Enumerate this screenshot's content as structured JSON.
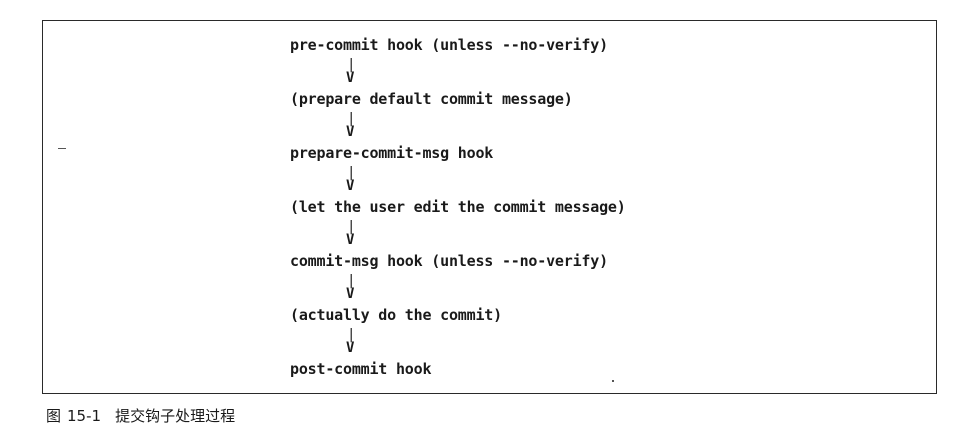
{
  "diagram": {
    "steps": [
      "pre-commit hook (unless --no-verify)",
      "(prepare default commit message)",
      "prepare-commit-msg hook",
      "(let the user edit the commit message)",
      "commit-msg hook (unless --no-verify)",
      "(actually do the commit)",
      "post-commit hook"
    ],
    "connector": {
      "bar": "|",
      "arrowhead": "V"
    }
  },
  "caption": {
    "prefix": "图",
    "number": "15-1",
    "title": "提交钩子处理过程"
  }
}
